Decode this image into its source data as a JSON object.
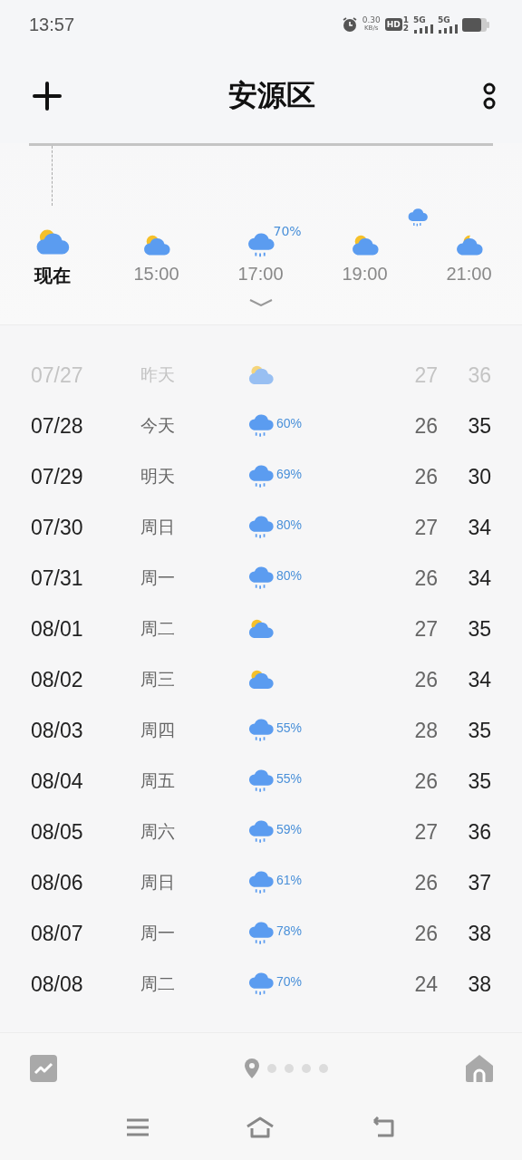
{
  "status_bar": {
    "time": "13:57",
    "net_speed": "0.30",
    "net_unit": "KB/s",
    "hd": "HD",
    "sim_slots": [
      "1",
      "2"
    ],
    "signals": [
      "5G",
      "5G"
    ]
  },
  "header": {
    "title": "安源区"
  },
  "hourly": [
    {
      "label": "现在",
      "kind": "sun-cloud",
      "selected": true
    },
    {
      "label": "15:00",
      "kind": "sun-cloud",
      "selected": false
    },
    {
      "label": "17:00",
      "kind": "rain",
      "precip": "70%",
      "selected": false
    },
    {
      "label": "19:00",
      "kind": "sun-cloud",
      "selected": false
    },
    {
      "label": "21:00",
      "kind": "moon-cloud",
      "selected": false
    }
  ],
  "daily": [
    {
      "date": "07/27",
      "day": "昨天",
      "kind": "sun-cloud",
      "low": "27",
      "high": "36",
      "past": true
    },
    {
      "date": "07/28",
      "day": "今天",
      "kind": "rain",
      "precip": "60%",
      "low": "26",
      "high": "35",
      "past": false
    },
    {
      "date": "07/29",
      "day": "明天",
      "kind": "rain",
      "precip": "69%",
      "low": "26",
      "high": "30",
      "past": false
    },
    {
      "date": "07/30",
      "day": "周日",
      "kind": "rain",
      "precip": "80%",
      "low": "27",
      "high": "34",
      "past": false
    },
    {
      "date": "07/31",
      "day": "周一",
      "kind": "rain",
      "precip": "80%",
      "low": "26",
      "high": "34",
      "past": false
    },
    {
      "date": "08/01",
      "day": "周二",
      "kind": "sun-cloud",
      "low": "27",
      "high": "35",
      "past": false
    },
    {
      "date": "08/02",
      "day": "周三",
      "kind": "sun-cloud",
      "low": "26",
      "high": "34",
      "past": false
    },
    {
      "date": "08/03",
      "day": "周四",
      "kind": "rain",
      "precip": "55%",
      "low": "28",
      "high": "35",
      "past": false
    },
    {
      "date": "08/04",
      "day": "周五",
      "kind": "rain",
      "precip": "55%",
      "low": "26",
      "high": "35",
      "past": false
    },
    {
      "date": "08/05",
      "day": "周六",
      "kind": "rain",
      "precip": "59%",
      "low": "27",
      "high": "36",
      "past": false
    },
    {
      "date": "08/06",
      "day": "周日",
      "kind": "rain",
      "precip": "61%",
      "low": "26",
      "high": "37",
      "past": false
    },
    {
      "date": "08/07",
      "day": "周一",
      "kind": "rain",
      "precip": "78%",
      "low": "26",
      "high": "38",
      "past": false
    },
    {
      "date": "08/08",
      "day": "周二",
      "kind": "rain",
      "precip": "70%",
      "low": "24",
      "high": "38",
      "past": false
    }
  ]
}
